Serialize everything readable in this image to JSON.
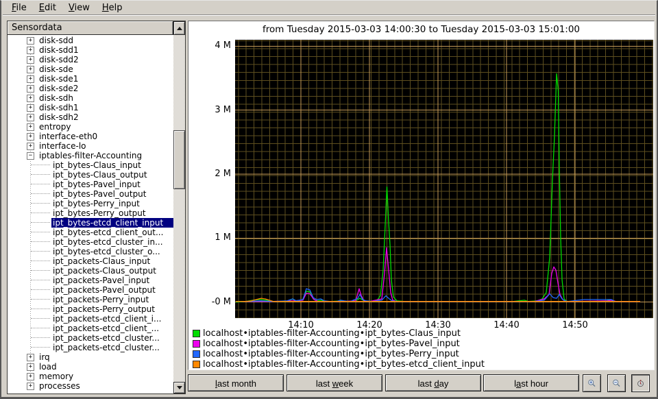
{
  "menu": {
    "items": [
      {
        "label": "File",
        "underline_index": 0
      },
      {
        "label": "Edit",
        "underline_index": 0
      },
      {
        "label": "View",
        "underline_index": 0
      },
      {
        "label": "Help",
        "underline_index": 0
      }
    ]
  },
  "sidebar": {
    "header": "Sensordata",
    "items": [
      {
        "label": "disk-sdd",
        "level": 0,
        "expander": "+"
      },
      {
        "label": "disk-sdd1",
        "level": 0,
        "expander": "+"
      },
      {
        "label": "disk-sdd2",
        "level": 0,
        "expander": "+"
      },
      {
        "label": "disk-sde",
        "level": 0,
        "expander": "+"
      },
      {
        "label": "disk-sde1",
        "level": 0,
        "expander": "+"
      },
      {
        "label": "disk-sde2",
        "level": 0,
        "expander": "+"
      },
      {
        "label": "disk-sdh",
        "level": 0,
        "expander": "+"
      },
      {
        "label": "disk-sdh1",
        "level": 0,
        "expander": "+"
      },
      {
        "label": "disk-sdh2",
        "level": 0,
        "expander": "+"
      },
      {
        "label": "entropy",
        "level": 0,
        "expander": "+"
      },
      {
        "label": "interface-eth0",
        "level": 0,
        "expander": "+"
      },
      {
        "label": "interface-lo",
        "level": 0,
        "expander": "+"
      },
      {
        "label": "iptables-filter-Accounting",
        "level": 0,
        "expander": "-"
      },
      {
        "label": "ipt_bytes-Claus_input",
        "level": 1
      },
      {
        "label": "ipt_bytes-Claus_output",
        "level": 1
      },
      {
        "label": "ipt_bytes-Pavel_input",
        "level": 1
      },
      {
        "label": "ipt_bytes-Pavel_output",
        "level": 1
      },
      {
        "label": "ipt_bytes-Perry_input",
        "level": 1
      },
      {
        "label": "ipt_bytes-Perry_output",
        "level": 1
      },
      {
        "label": "ipt_bytes-etcd_client_input",
        "level": 1,
        "selected": true
      },
      {
        "label": "ipt_bytes-etcd_client_out...",
        "level": 1
      },
      {
        "label": "ipt_bytes-etcd_cluster_in...",
        "level": 1
      },
      {
        "label": "ipt_bytes-etcd_cluster_o...",
        "level": 1
      },
      {
        "label": "ipt_packets-Claus_input",
        "level": 1
      },
      {
        "label": "ipt_packets-Claus_output",
        "level": 1
      },
      {
        "label": "ipt_packets-Pavel_input",
        "level": 1
      },
      {
        "label": "ipt_packets-Pavel_output",
        "level": 1
      },
      {
        "label": "ipt_packets-Perry_input",
        "level": 1
      },
      {
        "label": "ipt_packets-Perry_output",
        "level": 1
      },
      {
        "label": "ipt_packets-etcd_client_i...",
        "level": 1
      },
      {
        "label": "ipt_packets-etcd_client_...",
        "level": 1
      },
      {
        "label": "ipt_packets-etcd_cluster...",
        "level": 1
      },
      {
        "label": "ipt_packets-etcd_cluster...",
        "level": 1
      },
      {
        "label": "irq",
        "level": 0,
        "expander": "+"
      },
      {
        "label": "load",
        "level": 0,
        "expander": "+"
      },
      {
        "label": "memory",
        "level": 0,
        "expander": "+"
      },
      {
        "label": "processes",
        "level": 0,
        "expander": "+"
      }
    ]
  },
  "chart_data": {
    "type": "line",
    "title": "from Tuesday 2015-03-03 14:00:30 to Tuesday 2015-03-03 15:01:00",
    "x_unit": "minutes after 14:00",
    "y_unit": "bytes (M = 1e6)",
    "x_range": [
      0.4,
      61.4
    ],
    "y_range_M": [
      -0.25,
      4.1
    ],
    "grid": "on",
    "legend_position": "below",
    "x_ticks": [
      {
        "t": 10,
        "label": "14:10"
      },
      {
        "t": 20,
        "label": "14:20"
      },
      {
        "t": 30,
        "label": "14:30"
      },
      {
        "t": 40,
        "label": "14:40"
      },
      {
        "t": 50,
        "label": "14:50"
      }
    ],
    "y_ticks": [
      {
        "value": 4,
        "label": "4 M"
      },
      {
        "value": 3,
        "label": "3 M"
      },
      {
        "value": 2,
        "label": "2 M"
      },
      {
        "value": 1,
        "label": "1 M"
      },
      {
        "value": 0,
        "label": "-0 M"
      }
    ],
    "series": [
      {
        "name": "localhost•iptables-filter-Accounting•ipt_bytes-Claus_input",
        "color": "#00dd00",
        "points": [
          [
            0.5,
            0
          ],
          [
            2,
            0.01
          ],
          [
            3,
            0.03
          ],
          [
            4,
            0.04
          ],
          [
            5,
            0.03
          ],
          [
            6,
            0.01
          ],
          [
            7,
            0.01
          ],
          [
            8,
            0.01
          ],
          [
            8.8,
            0.05
          ],
          [
            9.3,
            0.02
          ],
          [
            10.2,
            0.03
          ],
          [
            10.8,
            0.17
          ],
          [
            11.3,
            0.16
          ],
          [
            11.8,
            0.05
          ],
          [
            12.3,
            0.02
          ],
          [
            13,
            0.03
          ],
          [
            13.6,
            0.01
          ],
          [
            14.5,
            0.01
          ],
          [
            16,
            0.02
          ],
          [
            17,
            0.01
          ],
          [
            18,
            0.02
          ],
          [
            18.6,
            0.06
          ],
          [
            19.2,
            0.02
          ],
          [
            20,
            0.01
          ],
          [
            21,
            0.01
          ],
          [
            21.6,
            0.1
          ],
          [
            22,
            0.5
          ],
          [
            22.3,
            1.2
          ],
          [
            22.55,
            1.8
          ],
          [
            22.8,
            1.25
          ],
          [
            23,
            0.9
          ],
          [
            23.2,
            0.35
          ],
          [
            23.5,
            0.08
          ],
          [
            24,
            0.02
          ],
          [
            25,
            0.01
          ],
          [
            27,
            0.01
          ],
          [
            29,
            0.01
          ],
          [
            31,
            0.01
          ],
          [
            33,
            0.01
          ],
          [
            35,
            0.01
          ],
          [
            37,
            0.01
          ],
          [
            39,
            0.01
          ],
          [
            41,
            0.01
          ],
          [
            42.6,
            0.03
          ],
          [
            43.2,
            0.01
          ],
          [
            44.5,
            0.02
          ],
          [
            45.2,
            0.05
          ],
          [
            45.8,
            0.15
          ],
          [
            46.3,
            0.7
          ],
          [
            46.7,
            1.9
          ],
          [
            47,
            2.6
          ],
          [
            47.3,
            3.57
          ],
          [
            47.55,
            3.3
          ],
          [
            47.7,
            2.1
          ],
          [
            47.9,
            1
          ],
          [
            48.1,
            0.35
          ],
          [
            48.4,
            0.05
          ],
          [
            48.8,
            0.01
          ],
          [
            50,
            0.01
          ],
          [
            52,
            0.01
          ],
          [
            54.6,
            0.02
          ],
          [
            55.1,
            0.04
          ],
          [
            55.6,
            0.01
          ],
          [
            57,
            0.01
          ],
          [
            59.5,
            0.01
          ]
        ]
      },
      {
        "name": "localhost•iptables-filter-Accounting•ipt_bytes-Pavel_input",
        "color": "#ee00ee",
        "points": [
          [
            0.5,
            0.01
          ],
          [
            3,
            0.01
          ],
          [
            6,
            0.01
          ],
          [
            9,
            0.02
          ],
          [
            10.3,
            0.03
          ],
          [
            10.8,
            0.14
          ],
          [
            11.3,
            0.13
          ],
          [
            11.9,
            0.04
          ],
          [
            12.5,
            0.01
          ],
          [
            14,
            0.01
          ],
          [
            16,
            0.01
          ],
          [
            18,
            0.02
          ],
          [
            18.5,
            0.21
          ],
          [
            18.8,
            0.1
          ],
          [
            19.2,
            0.02
          ],
          [
            20,
            0.01
          ],
          [
            21.8,
            0.05
          ],
          [
            22.2,
            0.45
          ],
          [
            22.5,
            0.85
          ],
          [
            22.8,
            0.5
          ],
          [
            23.1,
            0.15
          ],
          [
            23.4,
            0.03
          ],
          [
            24,
            0.01
          ],
          [
            28,
            0.01
          ],
          [
            34,
            0.01
          ],
          [
            40,
            0.01
          ],
          [
            44,
            0.01
          ],
          [
            45.5,
            0.05
          ],
          [
            46.2,
            0.12
          ],
          [
            46.6,
            0.45
          ],
          [
            46.9,
            0.55
          ],
          [
            47.2,
            0.5
          ],
          [
            47.5,
            0.3
          ],
          [
            47.8,
            0.12
          ],
          [
            48.2,
            0.04
          ],
          [
            48.6,
            0.01
          ],
          [
            50,
            0.01
          ],
          [
            54.8,
            0.02
          ],
          [
            55.3,
            0.03
          ],
          [
            56,
            0.01
          ],
          [
            59.5,
            0.01
          ]
        ]
      },
      {
        "name": "localhost•iptables-filter-Accounting•ipt_bytes-Perry_input",
        "color": "#2268ff",
        "points": [
          [
            0.5,
            0.01
          ],
          [
            2,
            0.01
          ],
          [
            4,
            0.02
          ],
          [
            6,
            0.01
          ],
          [
            8,
            0.02
          ],
          [
            8.8,
            0.05
          ],
          [
            9.3,
            0.02
          ],
          [
            10.3,
            0.04
          ],
          [
            10.8,
            0.21
          ],
          [
            11.3,
            0.19
          ],
          [
            11.8,
            0.07
          ],
          [
            12.3,
            0.04
          ],
          [
            12.9,
            0.05
          ],
          [
            13.4,
            0.02
          ],
          [
            14.2,
            0.01
          ],
          [
            15.2,
            0.01
          ],
          [
            15.8,
            0.03
          ],
          [
            16.3,
            0.02
          ],
          [
            17.2,
            0.01
          ],
          [
            18.3,
            0.06
          ],
          [
            18.6,
            0.12
          ],
          [
            19,
            0.04
          ],
          [
            19.5,
            0.02
          ],
          [
            20.5,
            0.01
          ],
          [
            21.8,
            0.03
          ],
          [
            22.4,
            0.1
          ],
          [
            22.9,
            0.05
          ],
          [
            23.3,
            0.02
          ],
          [
            24.2,
            0.01
          ],
          [
            27,
            0.01
          ],
          [
            30,
            0.01
          ],
          [
            33,
            0.01
          ],
          [
            36,
            0.01
          ],
          [
            39,
            0.01
          ],
          [
            42,
            0.01
          ],
          [
            44,
            0.01
          ],
          [
            45.5,
            0.03
          ],
          [
            46.3,
            0.13
          ],
          [
            46.8,
            0.07
          ],
          [
            47.3,
            0.06
          ],
          [
            47.7,
            0.12
          ],
          [
            48.1,
            0.05
          ],
          [
            48.5,
            0.02
          ],
          [
            49,
            0.01
          ],
          [
            51.3,
            0.04
          ],
          [
            53,
            0.04
          ],
          [
            55.3,
            0.04
          ],
          [
            55.7,
            0.02
          ]
        ]
      },
      {
        "name": "localhost•iptables-filter-Accounting•ipt_bytes-etcd_client_input",
        "color": "#ff8800",
        "points": [
          [
            0.5,
            0.01
          ],
          [
            2,
            0.01
          ],
          [
            2.8,
            0.02
          ],
          [
            3.5,
            0.04
          ],
          [
            4.2,
            0.06
          ],
          [
            4.8,
            0.05
          ],
          [
            5.4,
            0.03
          ],
          [
            6,
            0.01
          ],
          [
            7,
            0.01
          ],
          [
            10,
            0.01
          ],
          [
            15,
            0.01
          ],
          [
            20,
            0.01
          ],
          [
            25,
            0.01
          ],
          [
            30,
            0.01
          ],
          [
            35,
            0.01
          ],
          [
            40,
            0.01
          ],
          [
            45,
            0.01
          ],
          [
            50,
            0.01
          ],
          [
            55,
            0.01
          ],
          [
            59.5,
            0.01
          ]
        ]
      }
    ]
  },
  "toolbar": {
    "buttons": [
      {
        "label": "last month",
        "underline_index": 0
      },
      {
        "label": "last week",
        "underline_index": 5
      },
      {
        "label": "last day",
        "underline_index": 5
      },
      {
        "label": "last hour",
        "underline_index": 1
      }
    ],
    "icon_buttons": [
      {
        "icon": "zoom-in-icon",
        "pressed": false
      },
      {
        "icon": "zoom-out-icon",
        "pressed": false
      },
      {
        "icon": "clock-icon",
        "pressed": true
      }
    ]
  },
  "colors": {
    "window_bg": "#d4d0c8",
    "selection_bg": "#000080",
    "plot_bg": "#000000",
    "grid_minor": "#5e4f1f",
    "grid_major": "#c49a58"
  }
}
